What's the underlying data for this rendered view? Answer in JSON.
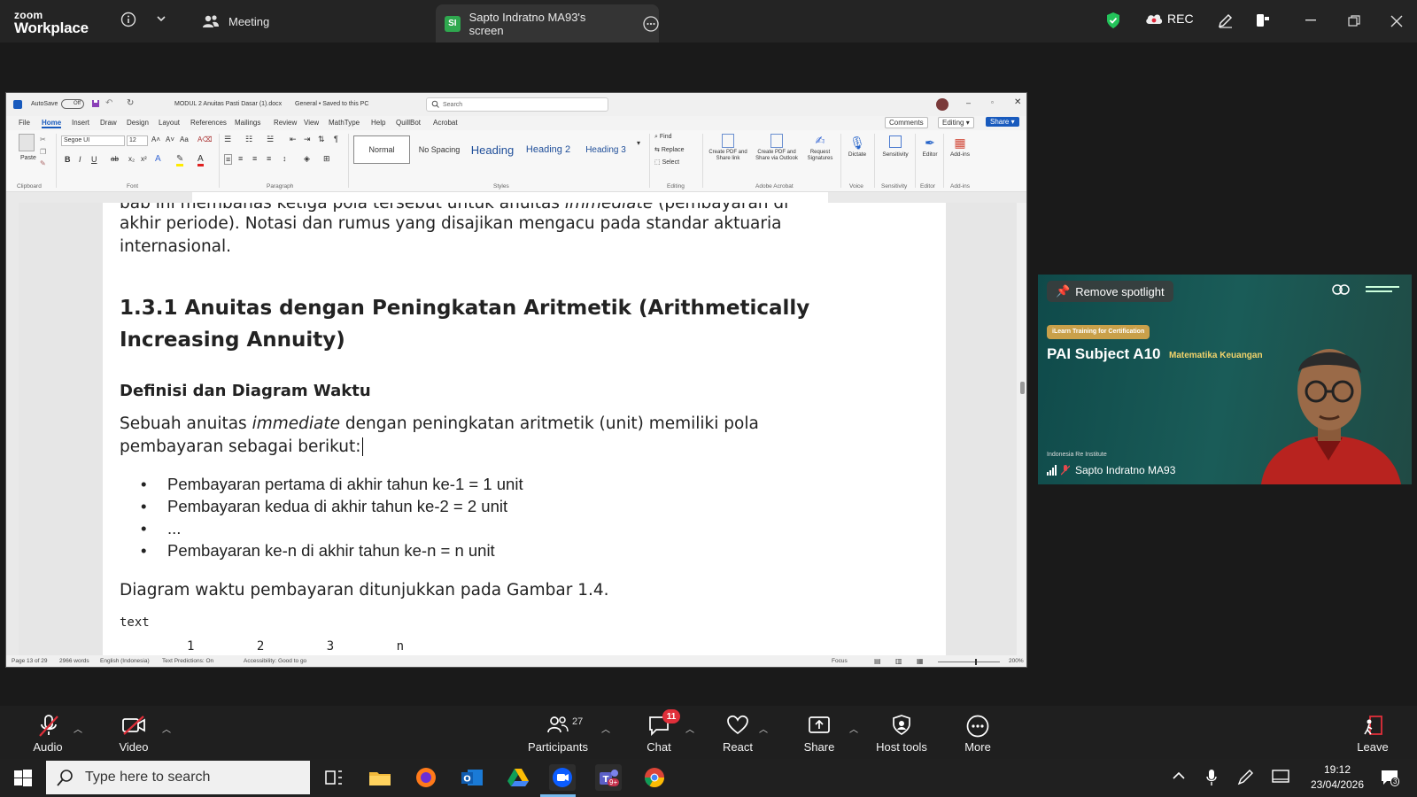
{
  "zoom": {
    "logo_top": "zoom",
    "logo_bottom": "Workplace",
    "meeting_tab": "Meeting",
    "screen_tab": "Sapto Indratno MA93's screen",
    "screen_tab_initials": "SI",
    "rec_label": "REC",
    "accent": "#0e72ed"
  },
  "word": {
    "autosave": "AutoSave",
    "autosave_state": "Off",
    "doc_title": "MODUL 2 Anuitas Pasti Dasar (1).docx",
    "saved_state": "General • Saved to this PC",
    "search_placeholder": "Search",
    "menu": [
      "File",
      "Home",
      "Insert",
      "Draw",
      "Design",
      "Layout",
      "References",
      "Mailings",
      "Review",
      "View",
      "MathType",
      "Help",
      "QuillBot",
      "Acrobat"
    ],
    "comments": "Comments",
    "editing": "Editing",
    "share": "Share",
    "font_name": "Segoe UI",
    "font_size": "12",
    "paste": "Paste",
    "styles": [
      "Normal",
      "No Spacing",
      "Heading",
      "Heading 2",
      "Heading 3"
    ],
    "editing_group": [
      "Find",
      "Replace",
      "Select"
    ],
    "acrobat_buttons": [
      "Create PDF and Share link",
      "Create PDF and Share via Outlook",
      "Request Signatures"
    ],
    "voice_button": "Dictate",
    "sensitivity_button": "Sensitivity",
    "editor_button": "Editor",
    "addins_button": "Add-ins",
    "group_labels": [
      "Clipboard",
      "Font",
      "Paragraph",
      "Styles",
      "Editing",
      "Adobe Acrobat",
      "Voice",
      "Sensitivity",
      "Editor",
      "Add-ins"
    ],
    "status": {
      "page": "Page 13 of 29",
      "words": "2966 words",
      "language": "English (Indonesia)",
      "predictions": "Text Predictions: On",
      "accessibility": "Accessibility: Good to go",
      "focus": "Focus",
      "zoom": "200%"
    }
  },
  "document": {
    "line_partial_top": "bab ini membahas ketiga pola tersebut untuk anuitas",
    "line_partial_top_italic": "immediate",
    "line_partial_top_end": "(pembayaran di",
    "line2": "akhir periode). Notasi dan rumus yang disajikan mengacu pada standar aktuaria",
    "line3": "internasional.",
    "heading_line1": "1.3.1 Anuitas dengan Peningkatan Aritmetik (Arithmetically",
    "heading_line2": "Increasing Annuity)",
    "subheading": "Definisi dan Diagram Waktu",
    "para_start": "Sebuah anuitas",
    "para_italic": "immediate",
    "para_end": "dengan peningkatan aritmetik (unit) memiliki pola",
    "para_line2": "pembayaran sebagai berikut:",
    "bullets": [
      "Pembayaran pertama di akhir tahun ke-1 = 1 unit",
      "Pembayaran kedua di akhir tahun ke-2 = 2 unit",
      "...",
      "Pembayaran ke-n di akhir tahun ke-n = n unit"
    ],
    "diagram_text": "Diagram waktu pembayaran ditunjukkan pada Gambar 1.4.",
    "code_label": "text",
    "cut_line": "1 2 3 n"
  },
  "video": {
    "remove_spotlight": "Remove spotlight",
    "badge": "iLearn Training for Certification",
    "title_main": "PAI Subject A10",
    "title_sub": "Matematika Keuangan",
    "institute": "Indonesia Re Institute",
    "participant_name": "Sapto Indratno MA93"
  },
  "toolbar": {
    "audio": "Audio",
    "video": "Video",
    "participants": "Participants",
    "participants_count": "27",
    "chat": "Chat",
    "chat_badge": "11",
    "react": "React",
    "share": "Share",
    "host_tools": "Host tools",
    "more": "More",
    "leave": "Leave"
  },
  "taskbar": {
    "search_placeholder": "Type here to search",
    "time": "19:12",
    "date": "23/04/2026",
    "notification_count": "3",
    "teams_badge": "9+"
  }
}
